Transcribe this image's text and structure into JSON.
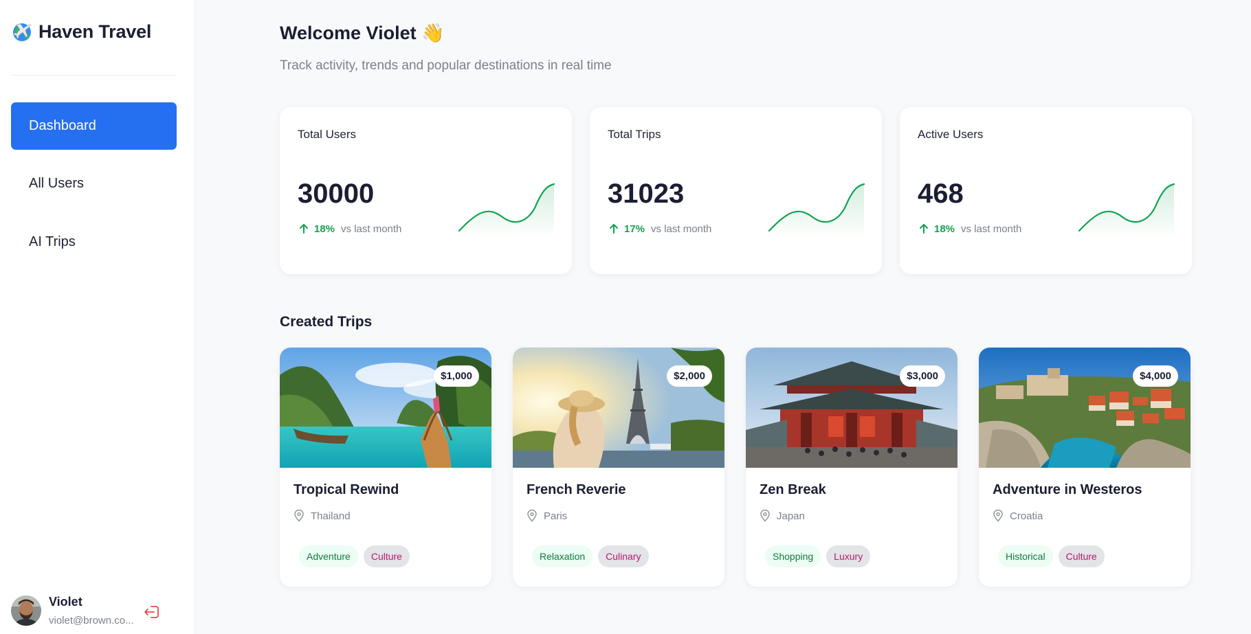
{
  "brand": {
    "name": "Haven Travel",
    "icon": "globe-airplane-icon"
  },
  "nav": {
    "items": [
      {
        "label": "Dashboard",
        "active": true
      },
      {
        "label": "All Users",
        "active": false
      },
      {
        "label": "AI Trips",
        "active": false
      }
    ]
  },
  "user": {
    "name": "Violet",
    "email": "violet@brown.co..."
  },
  "header": {
    "welcome": "Welcome Violet 👋",
    "subtitle": "Track activity, trends and popular destinations in real time"
  },
  "stats": [
    {
      "title": "Total Users",
      "value": "30000",
      "change": "18%",
      "vs": "vs last month"
    },
    {
      "title": "Total Trips",
      "value": "31023",
      "change": "17%",
      "vs": "vs last month"
    },
    {
      "title": "Active Users",
      "value": "468",
      "change": "18%",
      "vs": "vs last month"
    }
  ],
  "colors": {
    "accent": "#256ff1",
    "positive": "#12a150",
    "tagGreenBg": "#ecfdf3",
    "tagPinkText": "#b8176b"
  },
  "trips_section": {
    "title": "Created Trips"
  },
  "trips": [
    {
      "name": "Tropical Rewind",
      "location": "Thailand",
      "price": "$1,000",
      "tags": [
        "Adventure",
        "Culture"
      ]
    },
    {
      "name": "French Reverie",
      "location": "Paris",
      "price": "$2,000",
      "tags": [
        "Relaxation",
        "Culinary"
      ]
    },
    {
      "name": "Zen Break",
      "location": "Japan",
      "price": "$3,000",
      "tags": [
        "Shopping",
        "Luxury"
      ]
    },
    {
      "name": "Adventure in Westeros",
      "location": "Croatia",
      "price": "$4,000",
      "tags": [
        "Historical",
        "Culture"
      ]
    }
  ]
}
